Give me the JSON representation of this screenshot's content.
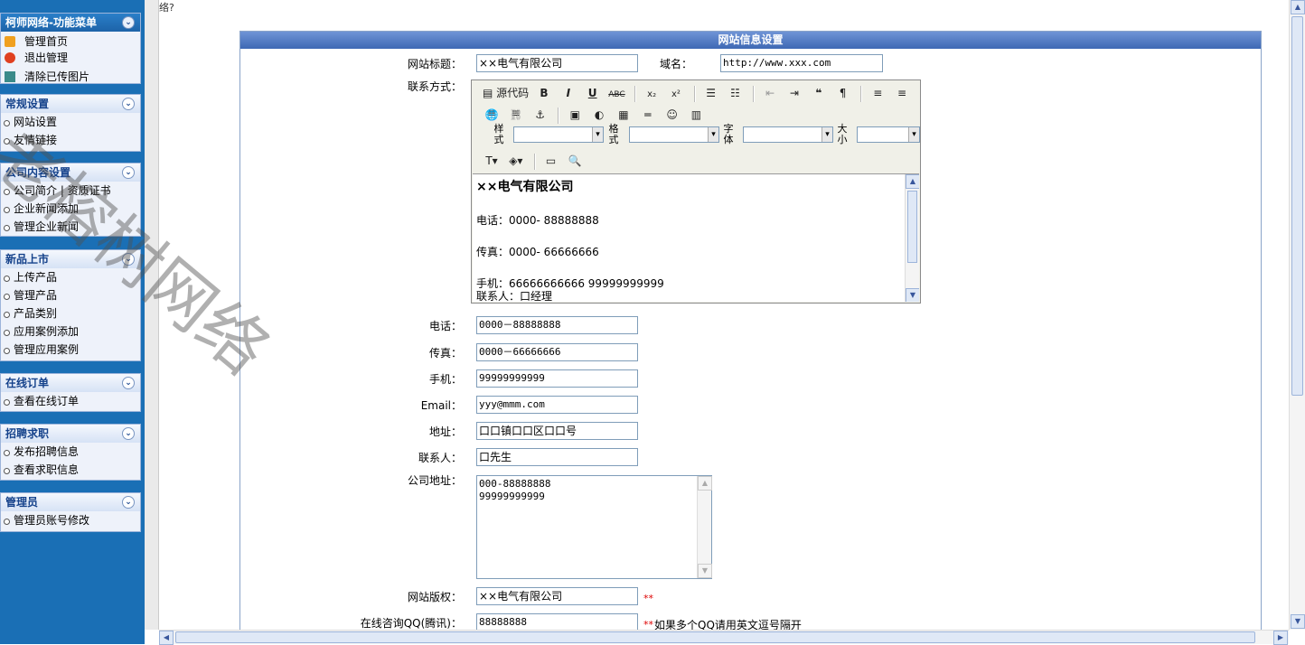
{
  "top_strip": "络?",
  "sidebar": {
    "title": "柯师网络-功能菜单",
    "top_links": [
      {
        "label": "管理首页"
      },
      {
        "label": "退出管理"
      },
      {
        "label": "清除已传图片"
      }
    ],
    "sections": [
      {
        "title": "常规设置",
        "items": [
          "网站设置",
          "友情链接"
        ]
      },
      {
        "title": "公司内容设置",
        "items": [
          "公司简介 | 资质证书",
          "企业新闻添加",
          "管理企业新闻"
        ]
      },
      {
        "title": "新品上市",
        "items": [
          "上传产品",
          "管理产品",
          "产品类别",
          "应用案例添加",
          "管理应用案例"
        ]
      },
      {
        "title": "在线订单",
        "items": [
          "查看在线订单"
        ]
      },
      {
        "title": "招聘求职",
        "items": [
          "发布招聘信息",
          "查看求职信息"
        ]
      },
      {
        "title": "管理员",
        "items": [
          "管理员账号修改"
        ]
      }
    ]
  },
  "form": {
    "header": "网站信息设置",
    "site_title_label": "网站标题：",
    "site_title_value": "××电气有限公司",
    "domain_label": "域名：",
    "domain_value": "http://www.xxx.com",
    "contact_label": "联系方式：",
    "editor": {
      "source_label": "源代码",
      "style_label": "样式",
      "format_label": "格式",
      "font_label": "字体",
      "size_label": "大小",
      "content": [
        "××电气有限公司",
        "电话：0000- 88888888",
        "传真：0000- 66666666",
        "手机：66666666666  99999999999",
        "联系人：口经理"
      ]
    },
    "phone_label": "电话：",
    "phone_value": "0000－88888888",
    "fax_label": "传真：",
    "fax_value": "0000－66666666",
    "mobile_label": "手机：",
    "mobile_value": "99999999999",
    "email_label": "Email：",
    "email_value": "yyy@mmm.com",
    "address_label": "地址：",
    "address_value": "口口镇口口区口口号",
    "contact_person_label": "联系人：",
    "contact_person_value": "口先生",
    "company_address_label": "公司地址：",
    "company_address_lines": [
      "000-88888888",
      "99999999999"
    ],
    "copyright_label": "网站版权：",
    "copyright_value": "××电气有限公司",
    "qq_label": "在线咨询QQ(腾讯)：",
    "qq_value": "88888888",
    "required_mark": "**",
    "qq_note": "如果多个QQ请用英文逗号隔开"
  },
  "watermark": "老榕树网络"
}
